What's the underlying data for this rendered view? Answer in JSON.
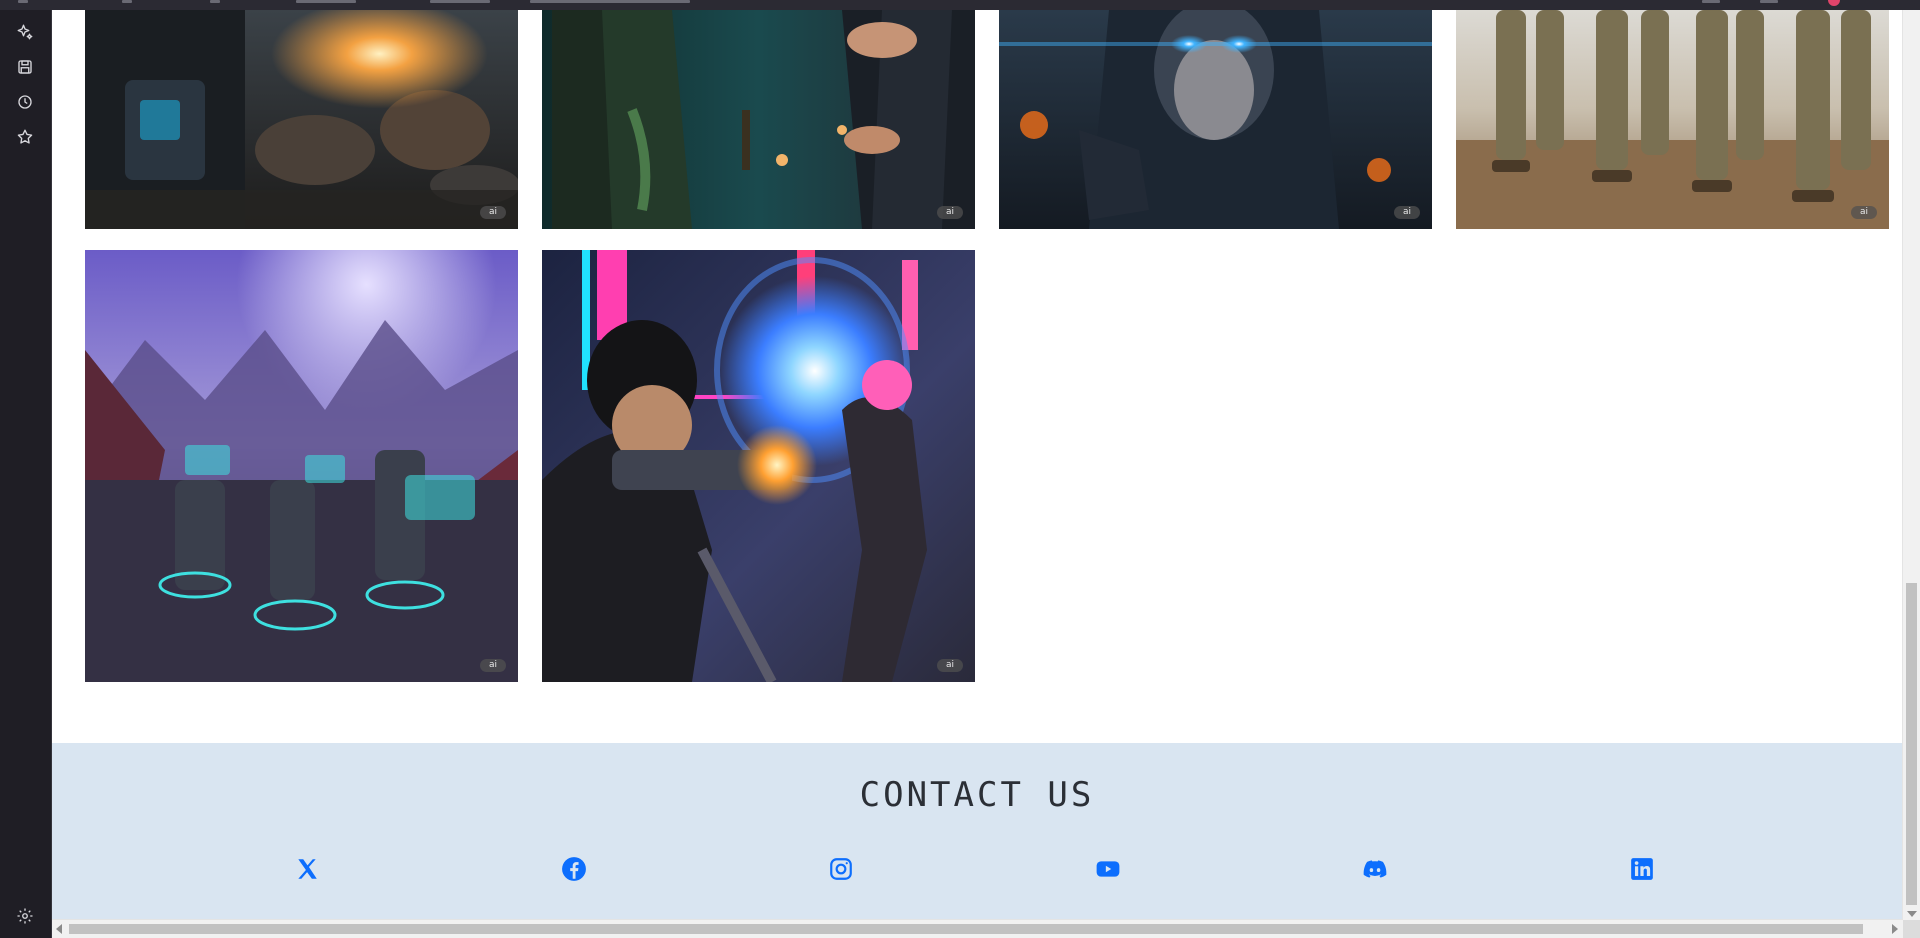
{
  "gallery": {
    "images": [
      {
        "name": "robot-battle-image",
        "badge": "ai"
      },
      {
        "name": "villain-suit-image",
        "badge": "ai"
      },
      {
        "name": "hooded-glowing-eyes-image",
        "badge": "ai"
      },
      {
        "name": "soldiers-desert-image",
        "badge": "ai"
      },
      {
        "name": "alien-planet-soldiers-image",
        "badge": "ai"
      },
      {
        "name": "neon-city-fight-image",
        "badge": "ai"
      }
    ]
  },
  "contact": {
    "title": "CONTACT US",
    "social": [
      {
        "name": "x-icon",
        "color": "#0d6efd"
      },
      {
        "name": "facebook-icon",
        "color": "#0d6efd"
      },
      {
        "name": "instagram-icon",
        "color": "#0d6efd"
      },
      {
        "name": "youtube-icon",
        "color": "#0d6efd"
      },
      {
        "name": "discord-icon",
        "color": "#0d6efd"
      },
      {
        "name": "linkedin-icon",
        "color": "#0d6efd"
      }
    ]
  },
  "sidebar": {
    "icons": [
      "sparkle-icon",
      "save-icon",
      "history-icon",
      "star-icon",
      "settings-icon"
    ]
  },
  "colors": {
    "accent": "#0d6efd",
    "contact_bg": "#d9e5f1",
    "sidebar_bg": "#1f1e25"
  }
}
